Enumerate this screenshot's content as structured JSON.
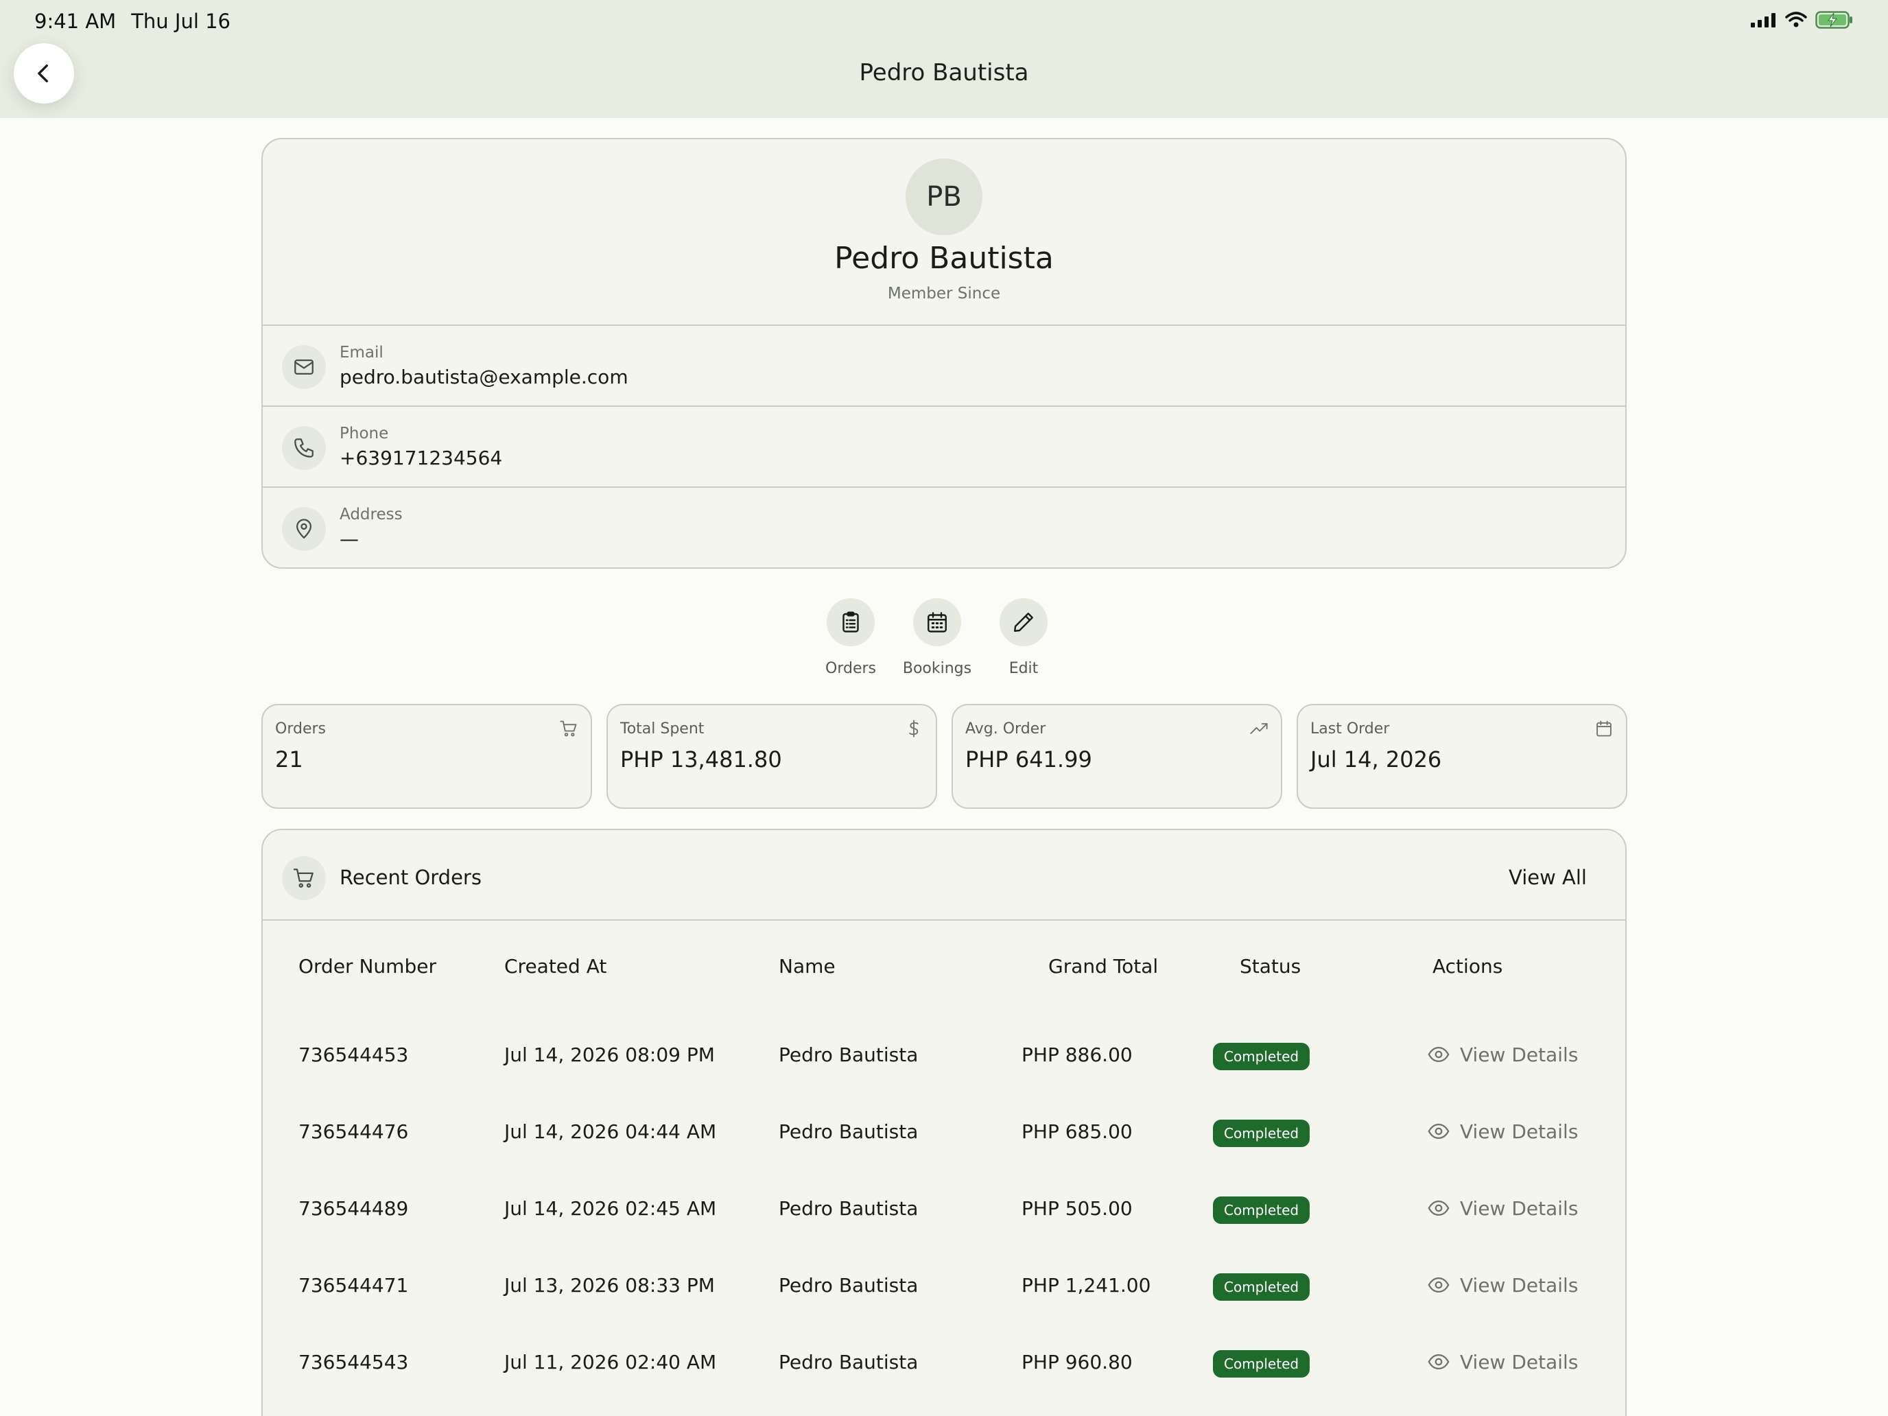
{
  "status_bar": {
    "time": "9:41 AM",
    "date": "Thu Jul 16",
    "icons": [
      "signal-icon",
      "wifi-icon",
      "battery-charging-icon"
    ]
  },
  "header": {
    "title": "Pedro Bautista",
    "back_icon": "chevron-left-icon"
  },
  "profile": {
    "initials": "PB",
    "name": "Pedro Bautista",
    "member_since_label": "Member Since",
    "email_label": "Email",
    "email": "pedro.bautista@example.com",
    "phone_label": "Phone",
    "phone": "+639171234564",
    "address_label": "Address",
    "address": "—"
  },
  "actions": [
    {
      "label": "Orders",
      "icon": "clipboard-list-icon"
    },
    {
      "label": "Bookings",
      "icon": "calendar-icon"
    },
    {
      "label": "Edit",
      "icon": "pencil-icon"
    }
  ],
  "stats": [
    {
      "label": "Orders",
      "value": "21",
      "icon": "cart-icon"
    },
    {
      "label": "Total Spent",
      "value": "PHP 13,481.80",
      "icon": "dollar-icon"
    },
    {
      "label": "Avg. Order",
      "value": "PHP 641.99",
      "icon": "trending-up-icon"
    },
    {
      "label": "Last Order",
      "value": "Jul 14, 2026",
      "icon": "calendar-icon"
    }
  ],
  "recent_orders": {
    "title": "Recent Orders",
    "view_all": "View All",
    "columns": [
      "Order Number",
      "Created At",
      "Name",
      "Grand Total",
      "Status",
      "Actions"
    ],
    "rows": [
      {
        "order_number": "736544453",
        "created_at": "Jul 14, 2026 08:09 PM",
        "name": "Pedro Bautista",
        "grand_total": "PHP 886.00",
        "status": "Completed",
        "action": "View Details"
      },
      {
        "order_number": "736544476",
        "created_at": "Jul 14, 2026 04:44 AM",
        "name": "Pedro Bautista",
        "grand_total": "PHP 685.00",
        "status": "Completed",
        "action": "View Details"
      },
      {
        "order_number": "736544489",
        "created_at": "Jul 14, 2026 02:45 AM",
        "name": "Pedro Bautista",
        "grand_total": "PHP 505.00",
        "status": "Completed",
        "action": "View Details"
      },
      {
        "order_number": "736544471",
        "created_at": "Jul 13, 2026 08:33 PM",
        "name": "Pedro Bautista",
        "grand_total": "PHP 1,241.00",
        "status": "Completed",
        "action": "View Details"
      },
      {
        "order_number": "736544543",
        "created_at": "Jul 11, 2026 02:40 AM",
        "name": "Pedro Bautista",
        "grand_total": "PHP 960.80",
        "status": "Completed",
        "action": "View Details"
      }
    ]
  },
  "colors": {
    "header_bg": "#e8ede1",
    "card_bg": "#f3f5ee",
    "border": "#c9cec3",
    "badge_bg": "#1f6b2c"
  }
}
